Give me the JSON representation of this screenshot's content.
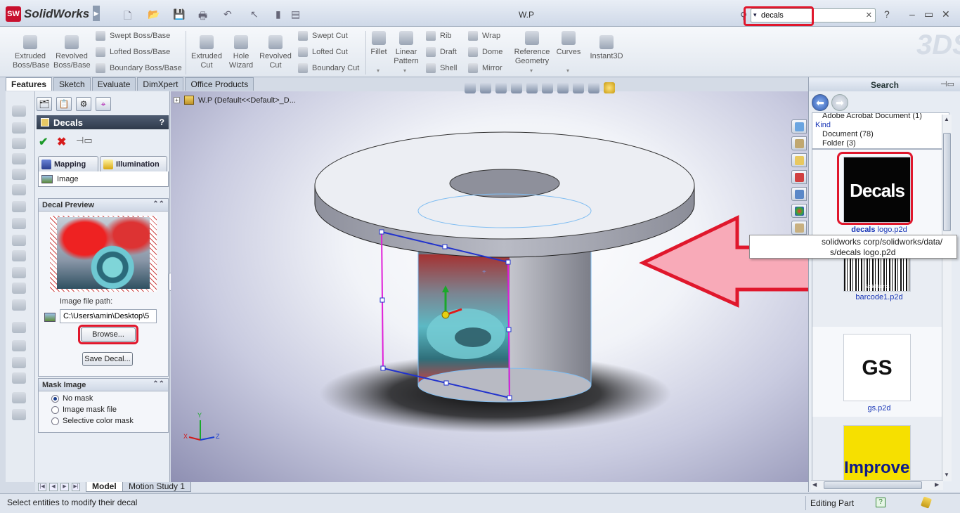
{
  "app": {
    "logo_badge": "SW",
    "name": "SolidWorks",
    "document_title": "W.P",
    "search_value": "decals",
    "window_buttons": [
      "?",
      "–",
      "▭",
      "✕"
    ]
  },
  "ribbon": {
    "large_buttons": [
      {
        "label1": "Extruded",
        "label2": "Boss/Base"
      },
      {
        "label1": "Revolved",
        "label2": "Boss/Base"
      },
      {
        "label1": "Extruded",
        "label2": "Cut"
      },
      {
        "label1": "Hole",
        "label2": "Wizard"
      },
      {
        "label1": "Revolved",
        "label2": "Cut"
      },
      {
        "label1": "Fillet",
        "label2": ""
      },
      {
        "label1": "Linear",
        "label2": "Pattern"
      },
      {
        "label1": "Reference",
        "label2": "Geometry"
      },
      {
        "label1": "Curves",
        "label2": ""
      },
      {
        "label1": "Instant3D",
        "label2": ""
      }
    ],
    "small_buttons": [
      "Swept Boss/Base",
      "Lofted Boss/Base",
      "Boundary Boss/Base",
      "Swept Cut",
      "Lofted Cut",
      "Boundary Cut",
      "Rib",
      "Draft",
      "Shell",
      "Wrap",
      "Dome",
      "Mirror"
    ]
  },
  "command_tabs": [
    "Features",
    "Sketch",
    "Evaluate",
    "DimXpert",
    "Office Products"
  ],
  "property_manager": {
    "title": "Decals",
    "help": "?",
    "ok": "✔",
    "cancel": "✖",
    "tab_mapping": "Mapping",
    "tab_illumination": "Illumination",
    "image_row": "Image",
    "group_preview": "Decal Preview",
    "file_path_label": "Image file path:",
    "file_path_value": "C:\\Users\\amin\\Desktop\\5",
    "browse_label": "Browse...",
    "save_decal_label": "Save Decal...",
    "group_mask": "Mask Image",
    "mask_options": [
      "No mask",
      "Image mask file",
      "Selective color mask"
    ],
    "mask_selected": "No mask"
  },
  "graphics": {
    "tree_item": "W.P  (Default<<Default>_D..."
  },
  "task_pane": {
    "header": "Search",
    "filters": {
      "line0": "Adobe Acrobat Document (1)",
      "kind_label": "Kind",
      "line1": "Document (78)",
      "line2": "Folder (3)"
    },
    "results": [
      {
        "name_bold": "decals",
        "name_rest": " logo.p2d",
        "thumb_text": "Decals"
      },
      {
        "name_bold": "",
        "name_rest": "barcode1.p2d",
        "thumb_text": "SolidWorks"
      },
      {
        "name_bold": "",
        "name_rest": "gs.p2d",
        "thumb_text": "GS"
      },
      {
        "name_bold": "",
        "name_rest": "",
        "thumb_text": "Improved"
      }
    ],
    "tooltip_line1": "solidworks corp/solidworks/data/",
    "tooltip_line2": "s/decals logo.p2d"
  },
  "bottom_tabs": [
    "Model",
    "Motion Study 1"
  ],
  "status": {
    "message": "Select entities to modify their decal",
    "mode": "Editing Part",
    "help_icon": "?"
  },
  "triad": {
    "x": "X",
    "y": "Y",
    "z": "Z"
  },
  "colors": {
    "highlight": "#e0172c",
    "arrow_fill": "#f8aab8",
    "pm_header": "#2f3a4b",
    "link_blue": "#1a37b7"
  }
}
